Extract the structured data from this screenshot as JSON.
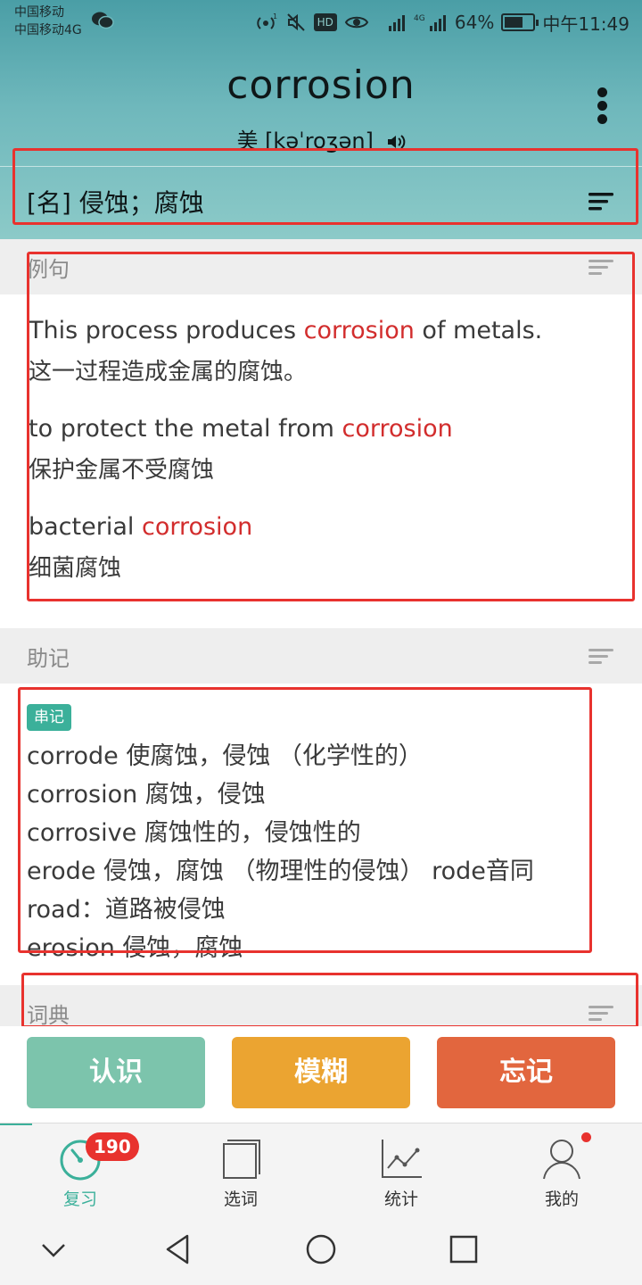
{
  "status_bar": {
    "carrier_line1": "中国移动",
    "carrier_line2": "中国移动4G",
    "battery_text": "64%",
    "battery_level": 0.64,
    "time": "中午11:49",
    "hd_label": "HD"
  },
  "word": {
    "headword": "corrosion",
    "phonetic": "美 [kəˈroʒən]"
  },
  "definition": "[名] 侵蚀；腐蚀",
  "examples_section": {
    "title": "例句",
    "items": [
      {
        "en_before": "This process produces ",
        "en_highlight": "corrosion",
        "en_after": " of metals.",
        "zh": "这一过程造成金属的腐蚀。"
      },
      {
        "en_before": "to protect the metal from ",
        "en_highlight": "corrosion",
        "en_after": "",
        "zh": "保护金属不受腐蚀"
      },
      {
        "en_before": "bacterial ",
        "en_highlight": "corrosion",
        "en_after": "",
        "zh": "细菌腐蚀"
      }
    ]
  },
  "mnemonic_section": {
    "title": "助记",
    "badge": "串记",
    "lines": [
      "corrode 使腐蚀，侵蚀 （化学性的）",
      "corrosion 腐蚀，侵蚀",
      "corrosive 腐蚀性的，侵蚀性的",
      "erode 侵蚀，腐蚀 （物理性的侵蚀） rode音同",
      "road：道路被侵蚀",
      "erosion 侵蚀，腐蚀"
    ]
  },
  "dictionary_section": {
    "title": "词典"
  },
  "actions": {
    "know": "认识",
    "vague": "模糊",
    "forget": "忘记"
  },
  "tabs": {
    "review": {
      "label": "复习",
      "badge": "190"
    },
    "select": {
      "label": "选词"
    },
    "stats": {
      "label": "统计"
    },
    "mine": {
      "label": "我的"
    }
  },
  "colors": {
    "accent": "#3bb09a",
    "highlight": "#d22d2d",
    "annotation": "#e8322e",
    "know": "#7cc4ac",
    "vague": "#eba431",
    "forget": "#e2663e"
  },
  "icons": [
    "wechat-icon",
    "hotspot-icon",
    "mute-icon",
    "eye-icon",
    "signal-icon",
    "battery-icon",
    "speaker-icon",
    "more-icon",
    "sort-icon",
    "review-icon",
    "book-icon",
    "chart-icon",
    "user-icon",
    "back-icon",
    "home-icon",
    "recents-icon"
  ]
}
